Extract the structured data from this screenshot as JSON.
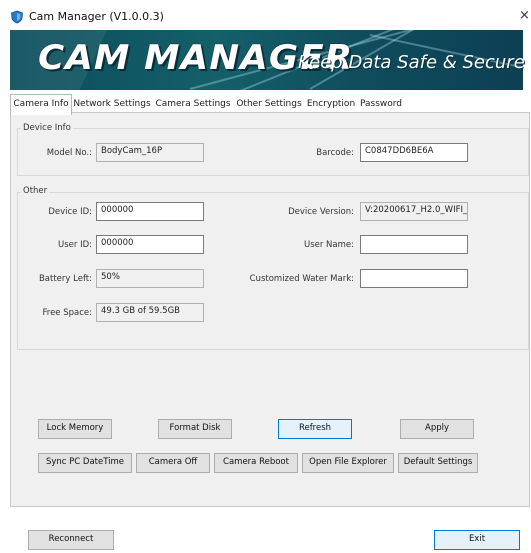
{
  "window": {
    "title": "Cam Manager (V1.0.0.3)",
    "close_glyph": "×"
  },
  "banner": {
    "logo": "CAM MANAGER",
    "tagline": "Keep Data Safe & Secure"
  },
  "tabs": [
    {
      "label": "Camera Info",
      "active": true
    },
    {
      "label": "Network Settings"
    },
    {
      "label": "Camera Settings"
    },
    {
      "label": "Other Settings"
    },
    {
      "label": "Encryption"
    },
    {
      "label": "Password"
    }
  ],
  "device_info": {
    "title": "Device Info",
    "model_label": "Model No.:",
    "model_value": "BodyCam_16P",
    "barcode_label": "Barcode:",
    "barcode_value": "C0847DD6BE6A"
  },
  "other": {
    "title": "Other",
    "device_id_label": "Device ID:",
    "device_id_value": "000000",
    "device_version_label": "Device Version:",
    "device_version_value": "V:20200617_H2.0_WIFI_(",
    "user_id_label": "User ID:",
    "user_id_value": "000000",
    "user_name_label": "User Name:",
    "user_name_value": "",
    "battery_label": "Battery Left:",
    "battery_value": "50%",
    "watermark_label": "Customized Water Mark:",
    "watermark_value": "",
    "free_space_label": "Free Space:",
    "free_space_value": "49.3 GB of 59.5GB"
  },
  "buttons": {
    "lock_memory": "Lock Memory",
    "format_disk": "Format Disk",
    "refresh": "Refresh",
    "apply": "Apply",
    "sync_pc_datetime": "Sync PC DateTime",
    "camera_off": "Camera Off",
    "camera_reboot": "Camera Reboot",
    "open_file_explorer": "Open File Explorer",
    "default_settings": "Default Settings",
    "reconnect": "Reconnect",
    "exit": "Exit"
  },
  "colors": {
    "banner": "#145f6a",
    "focus_border": "#0078d7",
    "panel": "#f0f0f0"
  }
}
